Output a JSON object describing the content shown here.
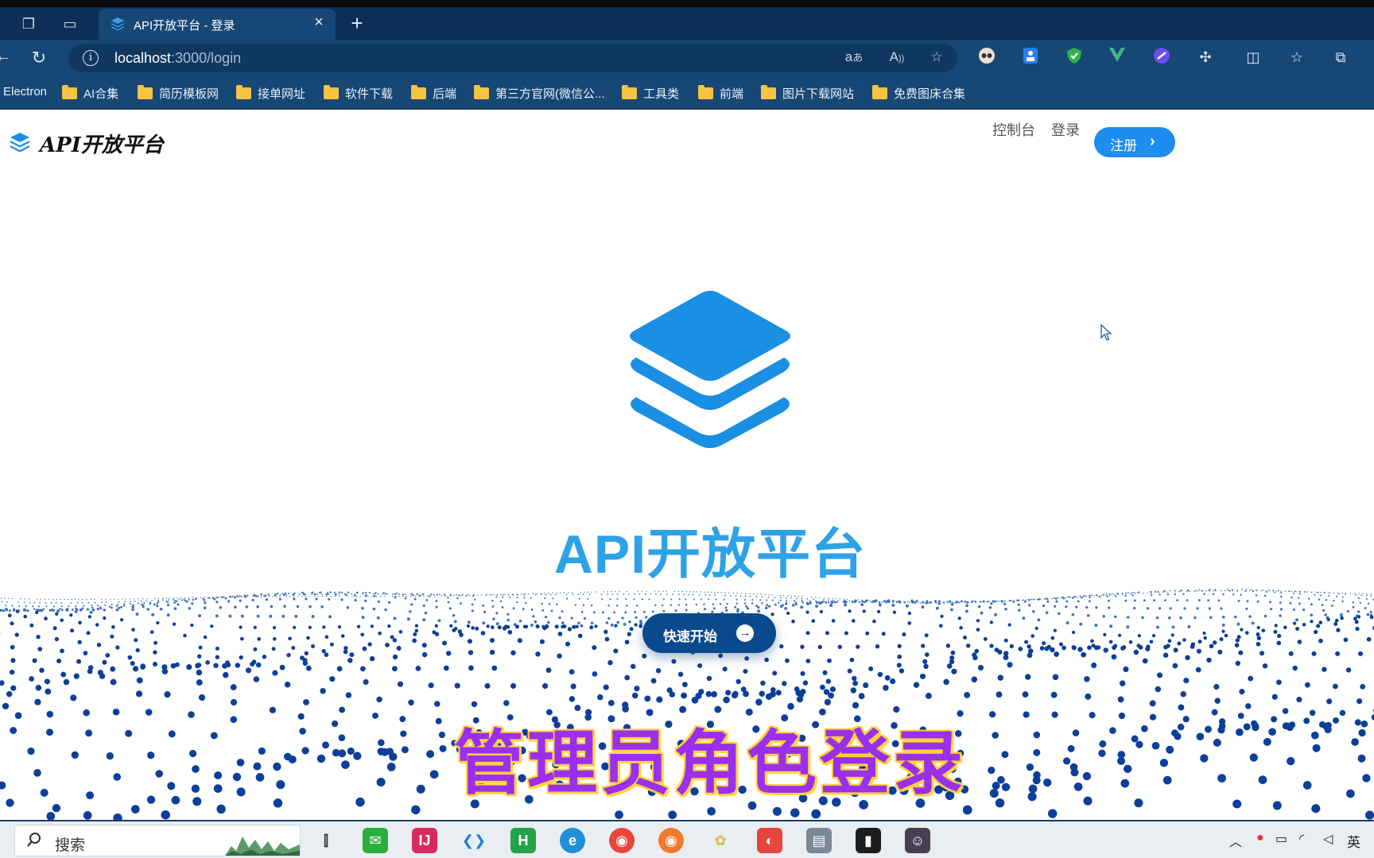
{
  "browser": {
    "tab_title": "API开放平台 - 登录",
    "tab_close": "×",
    "new_tab": "+",
    "url_host": "localhost",
    "url_rest": ":3000/login"
  },
  "bookmarks": [
    "Electron",
    "AI合集",
    "简历模板网",
    "接单网址",
    "软件下载",
    "后端",
    "第三方官网(微信公...",
    "工具类",
    "前端",
    "图片下载网站",
    "免费图床合集"
  ],
  "header": {
    "brand": "API开放平台",
    "nav_console": "控制台",
    "nav_login": "登录",
    "register": "注册"
  },
  "hero": {
    "title": "API开放平台",
    "cta": "快速开始"
  },
  "caption": "管理员角色登录",
  "taskbar": {
    "search_placeholder": "搜索",
    "ime": "英"
  },
  "colors": {
    "brand_blue": "#1a8fe3",
    "title_blue": "#2ea2e6",
    "cta_navy": "#0a4a8c",
    "caption_purple": "#9b2ff0",
    "caption_outline": "#ffd23a",
    "chrome_bg": "#164775"
  },
  "icons": [
    "workspaces-icon",
    "tab-actions-icon",
    "layers-favicon",
    "info-icon",
    "reload-icon",
    "read-aloud-icon",
    "translate-icon",
    "favorite-star-icon",
    "extension-icon",
    "split-screen-icon",
    "favorites-icon",
    "collections-icon",
    "search-icon",
    "arrow-right-icon",
    "mouse-cursor-icon"
  ]
}
